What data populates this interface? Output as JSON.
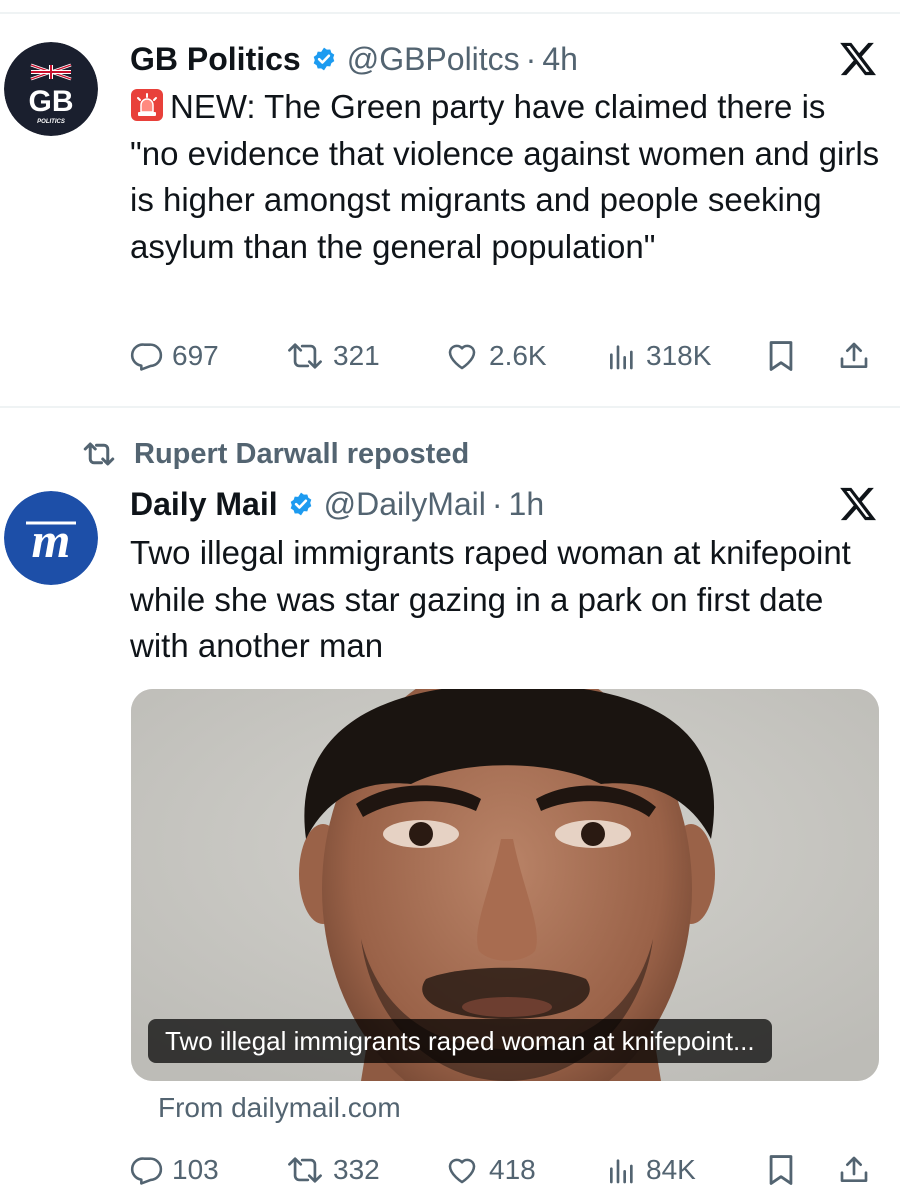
{
  "tweets": [
    {
      "display_name": "GB Politics",
      "handle": "@GBPolitcs",
      "separator": "·",
      "time": "4h",
      "avatar_text": "GB",
      "avatar_subtext": "POLITICS",
      "text": "NEW: The Green party have claimed there is \"no evidence that violence against women and girls is higher amongst migrants and people seeking asylum than the general population\"",
      "leading_icon": "siren-emoji",
      "stats": {
        "replies": "697",
        "reposts": "321",
        "likes": "2.6K",
        "views": "318K"
      }
    },
    {
      "repost_label": "Rupert Darwall reposted",
      "display_name": "Daily Mail",
      "handle": "@DailyMail",
      "separator": "·",
      "time": "1h",
      "text": "Two illegal immigrants raped woman at knifepoint while she was star gazing in a park on first date with another man",
      "card": {
        "caption": "Two illegal immigrants raped woman at knifepoint...",
        "source": "From dailymail.com",
        "image_subject": "mugshot-photo"
      },
      "stats": {
        "replies": "103",
        "reposts": "332",
        "likes": "418",
        "views": "84K"
      }
    }
  ],
  "colors": {
    "text": "#0f1419",
    "secondary": "#536471",
    "verified": "#1d9bf0",
    "daily_mail_blue": "#1d4fa8",
    "gb_avatar_bg": "#1a1f2e"
  }
}
